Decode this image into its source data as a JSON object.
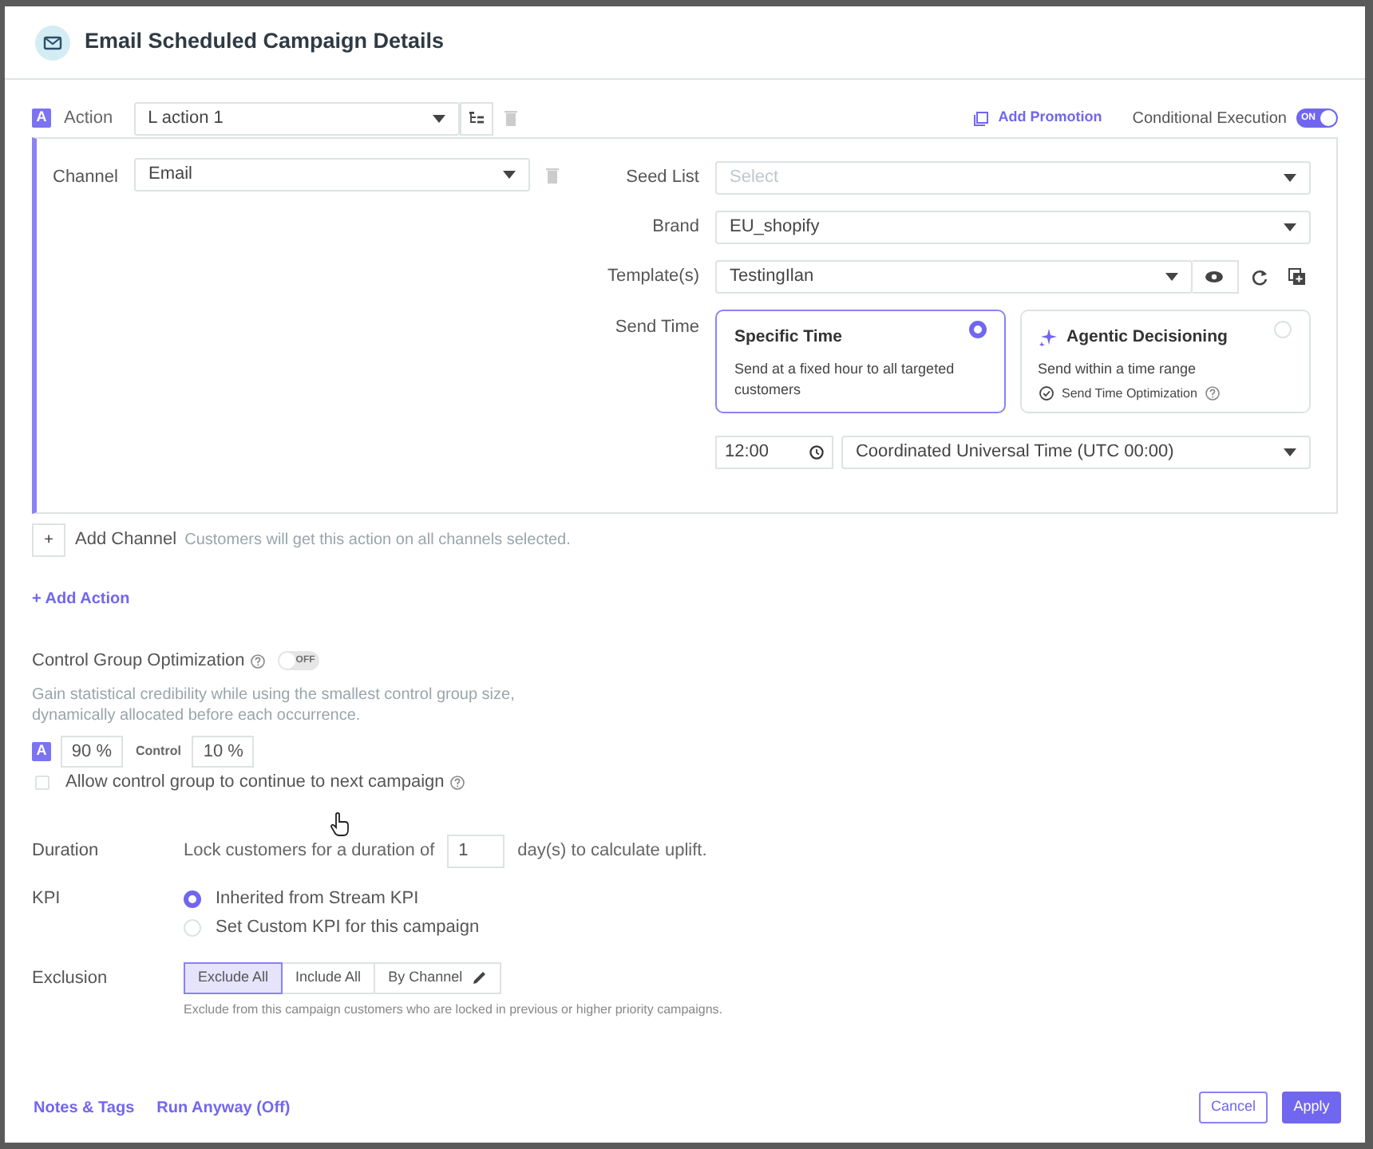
{
  "dialog": {
    "title": "Email Scheduled Campaign Details"
  },
  "action": {
    "badge": "A",
    "label": "Action",
    "value": "L action 1"
  },
  "add_promotion": "Add Promotion",
  "conditional_execution": {
    "label": "Conditional Execution",
    "on": true,
    "toggle_text": "ON"
  },
  "channel": {
    "label": "Channel",
    "value": "Email"
  },
  "fields": [
    {
      "label": "Seed List",
      "placeholder": "Select"
    },
    {
      "label": "Brand",
      "value": "EU_shopify"
    },
    {
      "label": "Template(s)",
      "value": "TestingIlan"
    }
  ],
  "send_time": {
    "label": "Send Time",
    "options": [
      {
        "kind": "fixed",
        "title": "Specific Time",
        "description": "Send at a fixed hour to all targeted customers",
        "selected": true
      },
      {
        "kind": "agentic",
        "title": "Agentic Decisioning",
        "description": "Send within a time range",
        "feature": "Send Time Optimization",
        "selected": false
      }
    ],
    "time": "12:00",
    "timezone": "Coordinated Universal Time (UTC 00:00)"
  },
  "add_channel": {
    "button": "+",
    "label": "Add Channel",
    "hint": "Customers will get this action on all channels selected."
  },
  "add_action": "+ Add Action",
  "control_group": {
    "label": "Control Group Optimization",
    "on": false,
    "toggle_text": "OFF",
    "description": "Gain statistical credibility while using the smallest control group size, dynamically allocated before each occurrence.",
    "badge": "A",
    "a_value": "90 %",
    "control_label": "Control",
    "control_value": "10 %",
    "allow": {
      "label": "Allow control group to continue to next campaign",
      "checked": false
    }
  },
  "duration": {
    "label": "Duration",
    "before": "Lock customers for a duration of",
    "value": "1",
    "after": "day(s) to calculate uplift."
  },
  "kpi": {
    "label": "KPI",
    "options": [
      {
        "label": "Inherited from Stream KPI",
        "selected": true
      },
      {
        "label": "Set Custom KPI for this campaign",
        "selected": false
      }
    ]
  },
  "exclusion": {
    "label": "Exclusion",
    "options": [
      {
        "label": "Exclude All",
        "selected": true,
        "editable": false
      },
      {
        "label": "Include All",
        "selected": false,
        "editable": false
      },
      {
        "label": "By Channel",
        "selected": false,
        "editable": true
      }
    ],
    "hint": "Exclude from this campaign customers who are locked in previous or higher priority campaigns."
  },
  "footer": {
    "links": [
      "Notes & Tags",
      "Run Anyway (Off)"
    ],
    "cancel": "Cancel",
    "apply": "Apply"
  }
}
